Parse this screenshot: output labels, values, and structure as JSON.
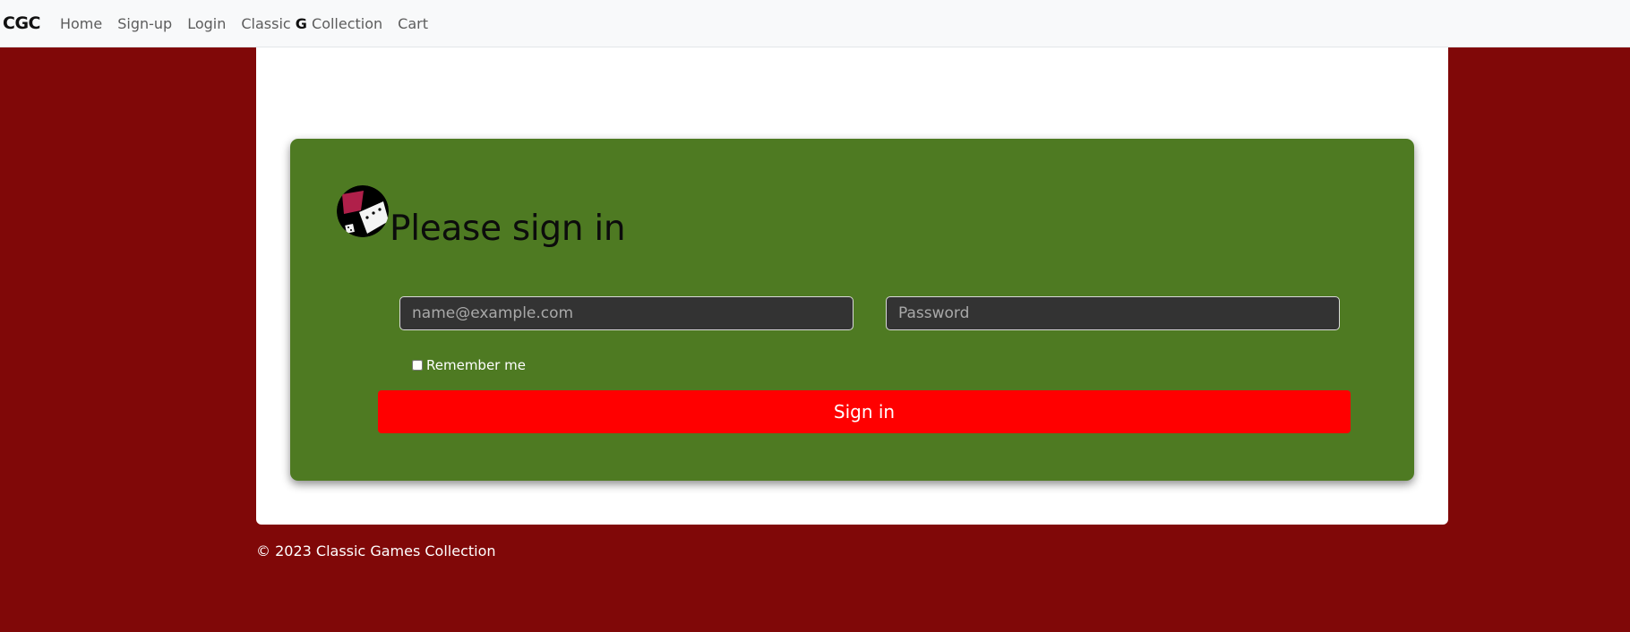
{
  "navbar": {
    "brand": "CGC",
    "links": {
      "home": "Home",
      "signup": "Sign-up",
      "login": "Login",
      "collection_prefix": "Classic ",
      "collection_bold": "G",
      "collection_suffix": " Collection",
      "cart": "Cart"
    }
  },
  "form": {
    "heading": "Please sign in",
    "email_placeholder": "name@example.com",
    "password_placeholder": "Password",
    "remember_label": "Remember me",
    "submit_label": "Sign in"
  },
  "footer": {
    "text": "© 2023 Classic Games Collection"
  },
  "colors": {
    "page_background": "#800808",
    "card_background": "#4e7a22",
    "button_background": "#ff0000",
    "input_background": "#333333"
  },
  "icons": {
    "logo": "game-logo-icon"
  }
}
